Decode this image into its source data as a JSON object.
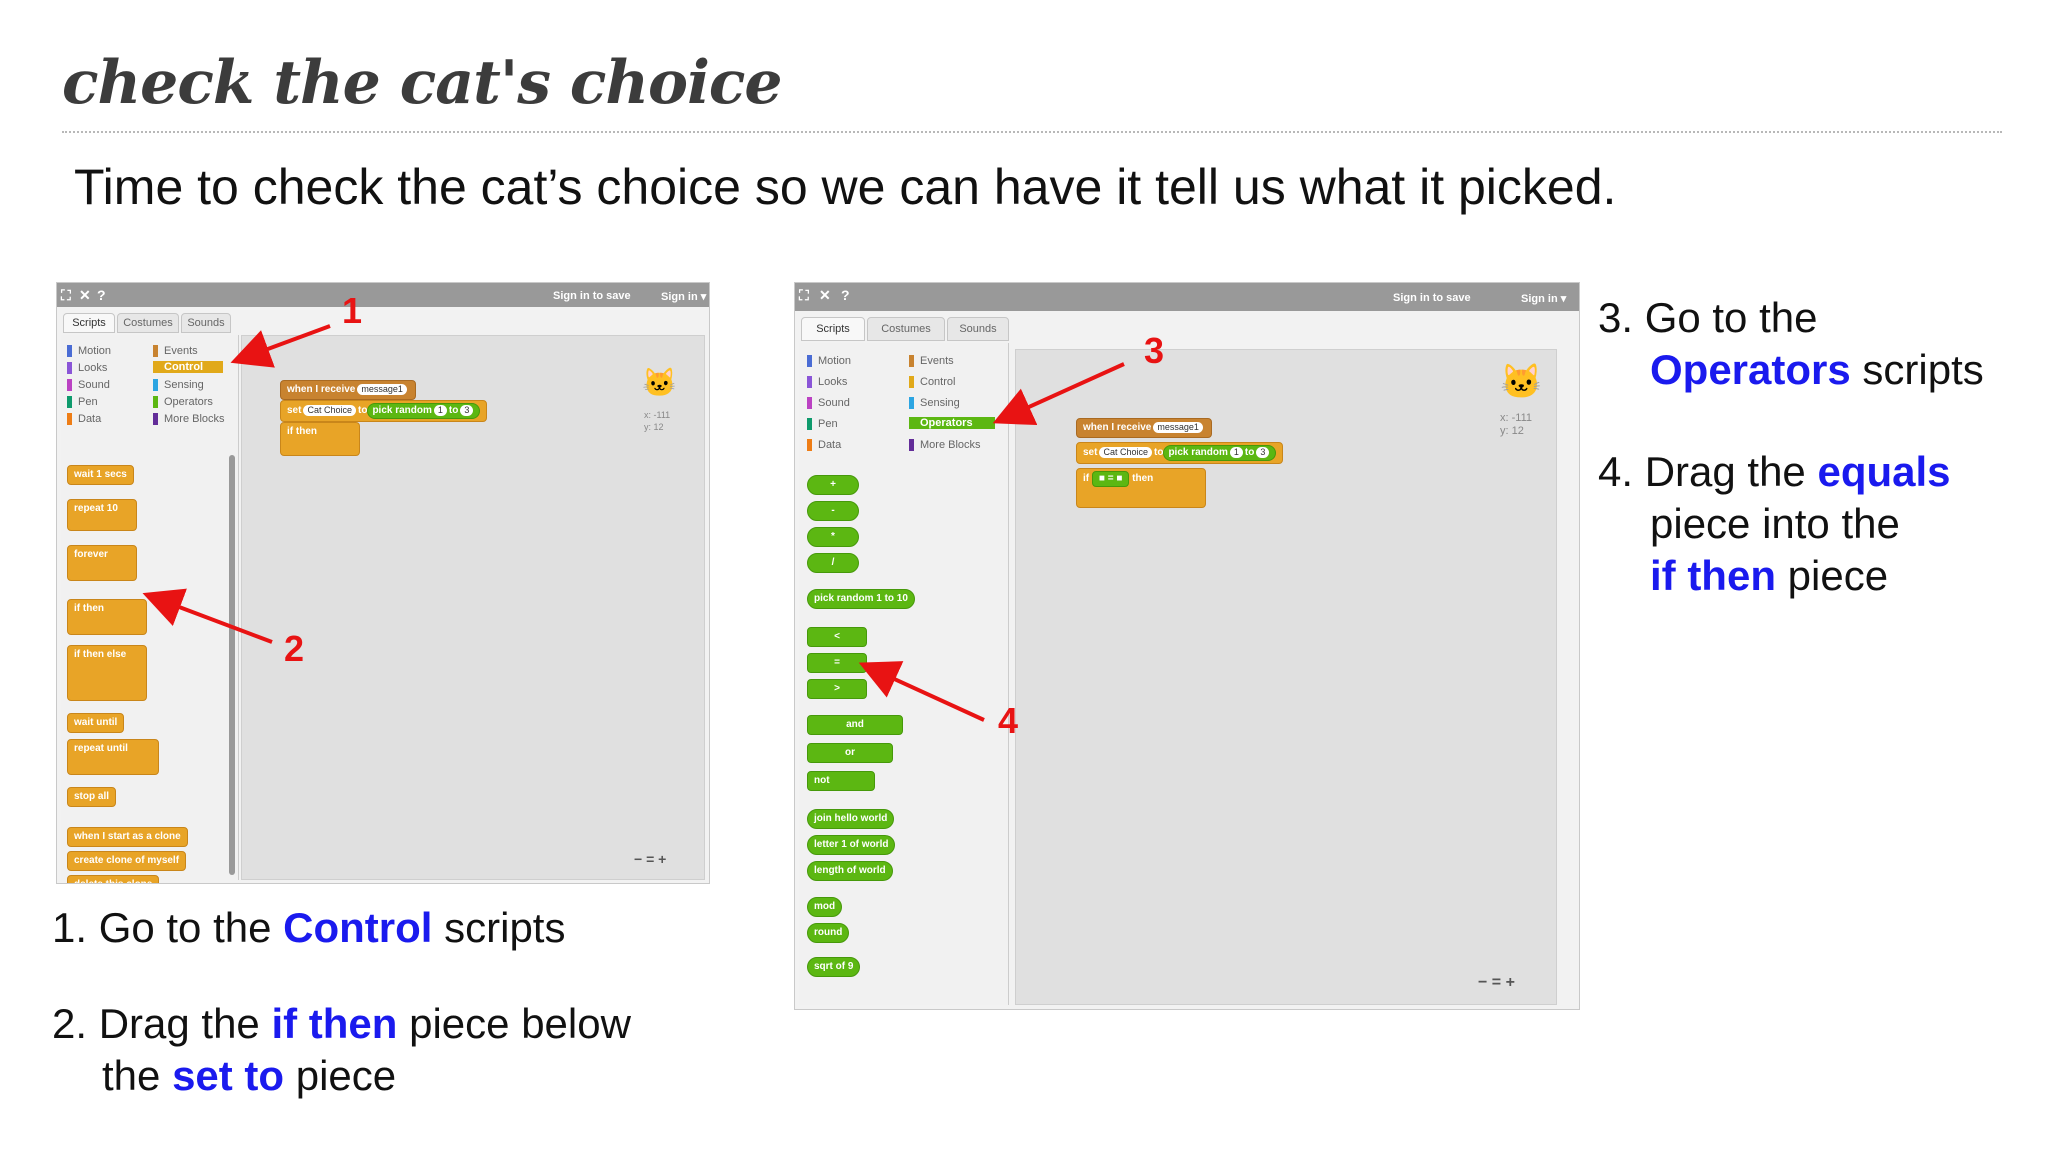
{
  "slide": {
    "title": "check the cat's choice",
    "intro": "Time to check the cat’s choice so we can have it tell us what it picked."
  },
  "instructions": {
    "step1": {
      "pre": "1. Go to the ",
      "highlight": "Control",
      "post": " scripts"
    },
    "step2": {
      "pre": "2. Drag the ",
      "highlight1": "if then",
      "mid": " piece below",
      "line2_pre": "the ",
      "highlight2": "set to",
      "post": " piece"
    },
    "step3": {
      "line1": "3. Go to the",
      "highlight": "Operators",
      "post": " scripts"
    },
    "step4": {
      "pre": "4. Drag the ",
      "highlight1": "equals",
      "line2": "piece into the",
      "highlight2": "if then",
      "post": " piece"
    }
  },
  "scratch": {
    "sign_in_save": "Sign in to save",
    "sign_in": "Sign in ▾",
    "tabs": [
      "Scripts",
      "Costumes",
      "Sounds"
    ],
    "categories_left": [
      "Motion",
      "Looks",
      "Sound",
      "Pen",
      "Data"
    ],
    "categories_right": [
      "Events",
      "Control",
      "Sensing",
      "Operators",
      "More Blocks"
    ],
    "colors": {
      "motion": "#4a6cd4",
      "looks": "#8a55d7",
      "sound": "#bb42c3",
      "pen": "#0e9a6c",
      "data": "#ee7d16",
      "events": "#c88330",
      "control": "#e1a91a",
      "sensing": "#2ca5e2",
      "operators": "#5cb712",
      "more": "#632d99"
    },
    "coords": {
      "x": "x: -111",
      "y": "y: 12"
    },
    "script": {
      "when_receive": "when I receive",
      "message": "message1",
      "set": "set",
      "var": "Cat Choice",
      "to": "to",
      "pick_random": "pick random",
      "n1": "1",
      "n_to": "to",
      "n3": "3",
      "if": "if",
      "then": "then"
    },
    "control_blocks": [
      "wait 1 secs",
      "repeat 10",
      "forever",
      "if then",
      "if then else",
      "wait until",
      "repeat until",
      "stop all",
      "when I start as a clone",
      "create clone of myself",
      "delete this clone"
    ],
    "operator_blocks": [
      "+",
      "-",
      "*",
      "/",
      "pick random 1 to 10",
      "<",
      "=",
      ">",
      "and",
      "or",
      "not",
      "join hello world",
      "letter 1 of world",
      "length of world",
      "mod",
      "round",
      "sqrt of 9"
    ],
    "zoom": "− = +"
  },
  "markers": [
    "1",
    "2",
    "3",
    "4"
  ]
}
